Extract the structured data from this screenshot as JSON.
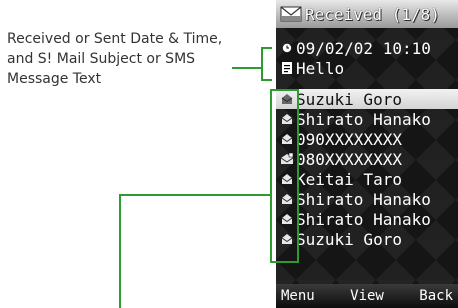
{
  "annotation": {
    "lines": [
      "Received or Sent Date & Time,",
      "and S! Mail Subject or SMS",
      "Message Text"
    ]
  },
  "colors": {
    "callout": "#2e9b32",
    "screen_bg": "#151515",
    "highlight": "#e4e4e4"
  },
  "screen": {
    "title": "Received (1/8)",
    "title_icon": "received-mail-folder-icon",
    "detail": {
      "datetime": "09/02/02 10:10",
      "datetime_icon": "clock-icon",
      "subject": "Hello",
      "subject_icon": "subject-icon"
    },
    "messages": [
      {
        "sender": "Suzuki Goro",
        "icon": "read-mail-icon",
        "selected": true
      },
      {
        "sender": "Shirato Hanako",
        "icon": "read-mail-icon",
        "selected": false
      },
      {
        "sender": "090XXXXXXXX",
        "icon": "read-mail-icon",
        "selected": false
      },
      {
        "sender": "080XXXXXXXX",
        "icon": "sms-icon",
        "selected": false
      },
      {
        "sender": "Keitai Taro",
        "icon": "read-mail-icon",
        "selected": false
      },
      {
        "sender": "Shirato Hanako",
        "icon": "read-mail-icon",
        "selected": false
      },
      {
        "sender": "Shirato Hanako",
        "icon": "read-mail-icon",
        "selected": false
      },
      {
        "sender": "Suzuki Goro",
        "icon": "read-mail-icon",
        "selected": false
      }
    ],
    "softkeys": {
      "left": "Menu",
      "center": "View",
      "right": "Back"
    }
  }
}
